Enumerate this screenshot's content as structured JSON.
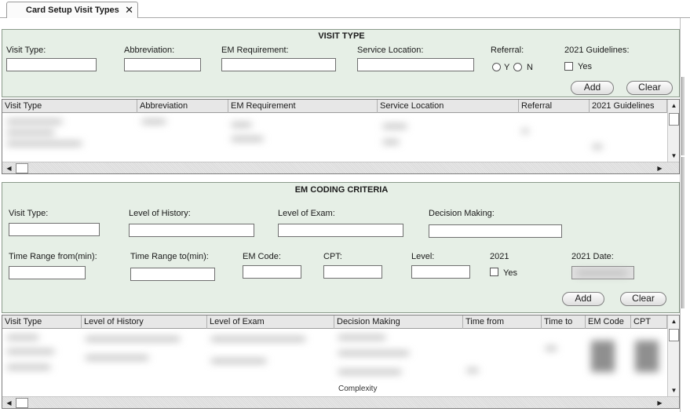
{
  "tab": {
    "title": "Card Setup Visit Types",
    "close": "✕"
  },
  "visit_type": {
    "title": "VISIT TYPE",
    "labels": {
      "visit_type": "Visit Type:",
      "abbreviation": "Abbreviation:",
      "em_requirement": "EM Requirement:",
      "service_location": "Service Location:",
      "referral": "Referral:",
      "guidelines": "2021 Guidelines:"
    },
    "values": {
      "visit_type": "",
      "abbreviation": "",
      "em_requirement": "",
      "service_location": ""
    },
    "referral_y": "Y",
    "referral_n": "N",
    "guidelines_yes": "Yes",
    "add": "Add",
    "clear": "Clear"
  },
  "visit_grid": {
    "columns": [
      "Visit Type",
      "Abbreviation",
      "EM Requirement",
      "Service Location",
      "Referral",
      "2021 Guidelines"
    ]
  },
  "em_coding": {
    "title": "EM CODING CRITERIA",
    "labels": {
      "visit_type": "Visit Type:",
      "level_history": "Level of History:",
      "level_exam": "Level of Exam:",
      "decision_making": "Decision Making:",
      "time_from": "Time Range from(min):",
      "time_to": "Time Range to(min):",
      "em_code": "EM Code:",
      "cpt": "CPT:",
      "level": "Level:",
      "year": "2021",
      "date": "2021 Date:"
    },
    "yes": "Yes",
    "add": "Add",
    "clear": "Clear"
  },
  "em_grid": {
    "columns": [
      "Visit Type",
      "Level of History",
      "Level of Exam",
      "Decision Making",
      "Time from",
      "Time to",
      "EM Code",
      "CPT"
    ],
    "visible_fragment": "Complexity"
  },
  "icons": {
    "close": "close-icon",
    "scroll_up": "triangle-up-icon",
    "scroll_down": "triangle-down-icon",
    "scroll_left": "triangle-left-icon",
    "scroll_right": "triangle-right-icon"
  },
  "colors": {
    "panel_bg": "#e6efe6",
    "panel_border": "#8b9a8b",
    "grid_header": "#e7e7e7"
  }
}
